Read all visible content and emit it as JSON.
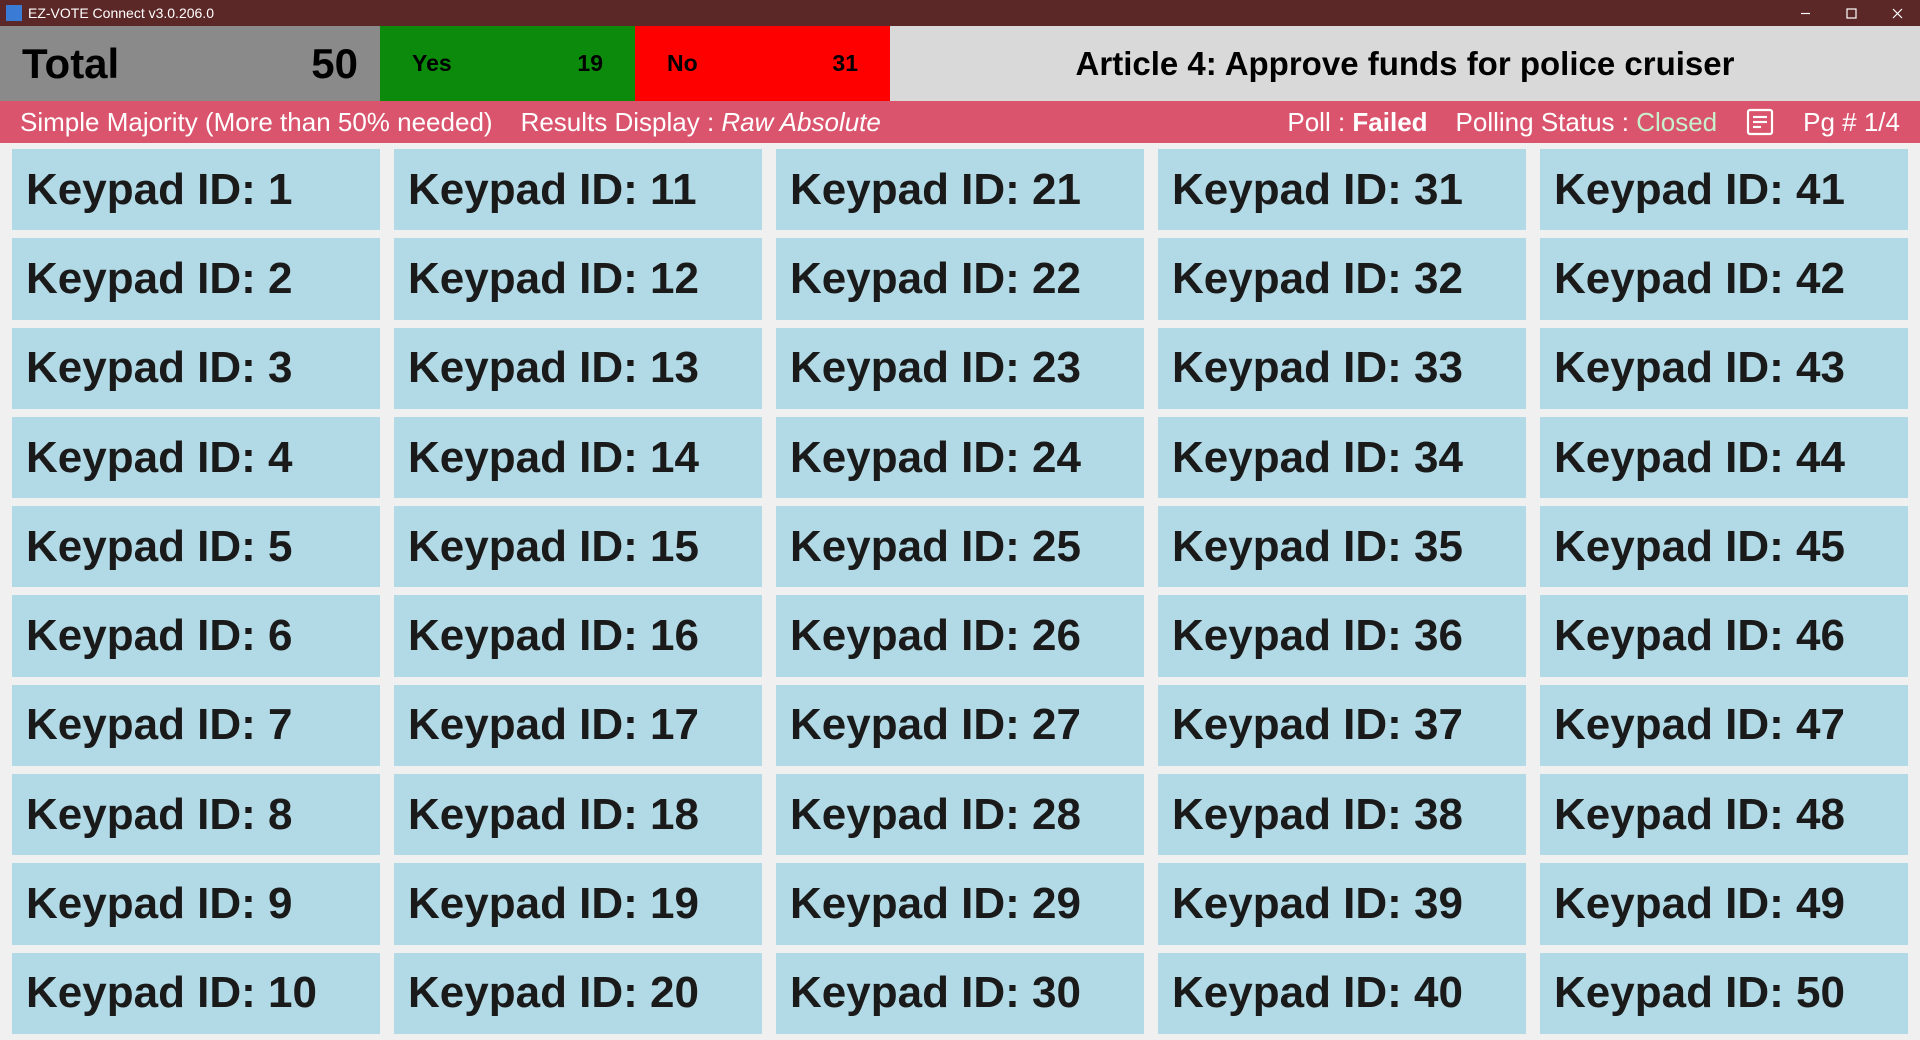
{
  "window": {
    "title": "EZ-VOTE Connect v3.0.206.0"
  },
  "summary": {
    "total_label": "Total",
    "total_value": "50",
    "yes_label": "Yes",
    "yes_value": "19",
    "no_label": "No",
    "no_value": "31",
    "question": "Article 4: Approve funds for police cruiser"
  },
  "status": {
    "majority_rule": "Simple Majority (More than 50% needed)",
    "results_display_label": "Results Display : ",
    "results_display_value": "Raw Absolute",
    "poll_label": "Poll : ",
    "poll_result": "Failed",
    "polling_status_label": "Polling Status : ",
    "polling_status_value": "Closed",
    "page_label": "Pg # 1/4"
  },
  "keypad_prefix": "Keypad ID: ",
  "keypads": {
    "col1": [
      "1",
      "2",
      "3",
      "4",
      "5",
      "6",
      "7",
      "8",
      "9",
      "10"
    ],
    "col2": [
      "11",
      "12",
      "13",
      "14",
      "15",
      "16",
      "17",
      "18",
      "19",
      "20"
    ],
    "col3": [
      "21",
      "22",
      "23",
      "24",
      "25",
      "26",
      "27",
      "28",
      "29",
      "30"
    ],
    "col4": [
      "31",
      "32",
      "33",
      "34",
      "35",
      "36",
      "37",
      "38",
      "39",
      "40"
    ],
    "col5": [
      "41",
      "42",
      "43",
      "44",
      "45",
      "46",
      "47",
      "48",
      "49",
      "50"
    ]
  }
}
